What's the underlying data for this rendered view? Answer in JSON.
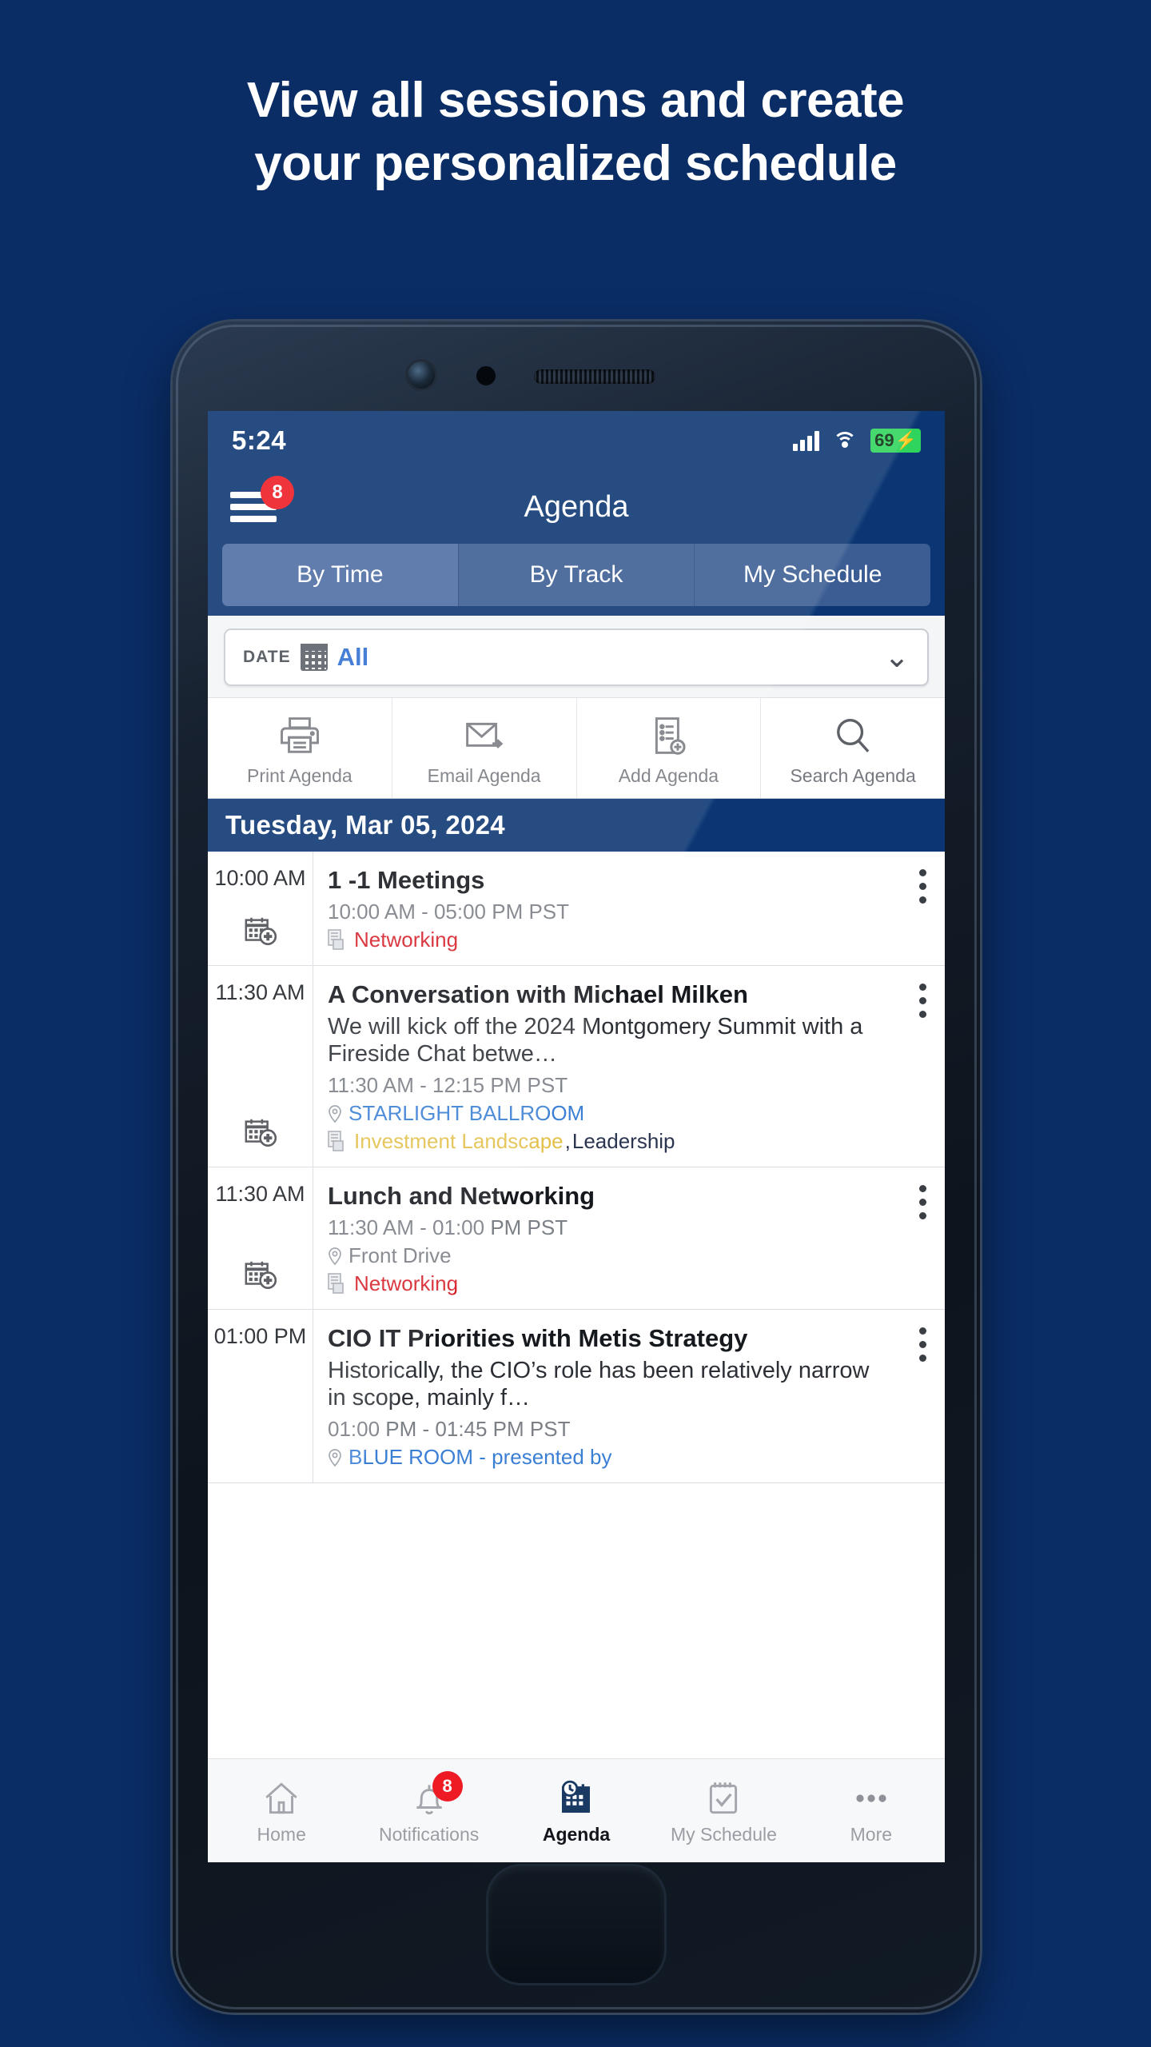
{
  "promo": {
    "headline_line1": "View all sessions and create",
    "headline_line2": "your personalized schedule",
    "background_color": "#0a2d66"
  },
  "status_bar": {
    "time": "5:24",
    "signal_icon": "signal-bars-icon",
    "wifi_icon": "wifi-icon",
    "battery_level": "69",
    "battery_charging": "⚡"
  },
  "app_bar": {
    "menu_icon": "hamburger-menu-icon",
    "menu_badge": "8",
    "title": "Agenda"
  },
  "segmented_tabs": [
    {
      "label": "By Time",
      "selected": true
    },
    {
      "label": "By Track",
      "selected": false
    },
    {
      "label": "My Schedule",
      "selected": false
    }
  ],
  "date_filter": {
    "label": "DATE",
    "calendar_icon": "calendar-icon",
    "value": "All",
    "chevron_icon": "chevron-down-icon"
  },
  "toolbar": [
    {
      "label": "Print Agenda",
      "icon": "printer-icon"
    },
    {
      "label": "Email Agenda",
      "icon": "envelope-icon"
    },
    {
      "label": "Add Agenda",
      "icon": "document-add-icon"
    },
    {
      "label": "Search Agenda",
      "icon": "search-icon"
    }
  ],
  "date_band": "Tuesday, Mar 05, 2024",
  "sessions": [
    {
      "time": "10:00 AM",
      "title": "1 -1 Meetings",
      "description": "",
      "timerange": "10:00 AM - 05:00 PM PST",
      "location": "",
      "location_color": "",
      "tracks": [
        {
          "text": "Networking",
          "color": "#d6212b"
        }
      ],
      "add_icon": "calendar-add-icon",
      "menu_icon": "kebab-menu-icon"
    },
    {
      "time": "11:30 AM",
      "title": "A Conversation with Michael Milken",
      "description": "We will kick off the 2024 Montgomery Summit with a Fireside Chat betwe…",
      "timerange": "11:30 AM - 12:15 PM PST",
      "location": "STARLIGHT BALLROOM",
      "location_color": "#3b7fd4",
      "tracks": [
        {
          "text": "Investment Landscape",
          "color": "#e3c04a"
        },
        {
          "text": ", ",
          "color": "#2b3550"
        },
        {
          "text": "Leadership",
          "color": "#2b3550"
        }
      ],
      "add_icon": "calendar-add-icon",
      "menu_icon": "kebab-menu-icon"
    },
    {
      "time": "11:30 AM",
      "title": "Lunch and Networking",
      "description": "",
      "timerange": "11:30 AM - 01:00 PM PST",
      "location": "Front Drive",
      "location_color": "#7b7f86",
      "tracks": [
        {
          "text": "Networking",
          "color": "#d6212b"
        }
      ],
      "add_icon": "calendar-add-icon",
      "menu_icon": "kebab-menu-icon"
    },
    {
      "time": "01:00 PM",
      "title": "CIO IT Priorities with Metis Strategy",
      "description": "Historically, the CIO’s role has been relatively narrow in scope, mainly f…",
      "timerange": "01:00 PM - 01:45 PM PST",
      "location": "BLUE ROOM  - presented by",
      "location_color": "#3b7fd4",
      "tracks": [],
      "add_icon": "calendar-add-icon",
      "menu_icon": "kebab-menu-icon"
    }
  ],
  "bottom_nav": [
    {
      "label": "Home",
      "icon": "home-icon",
      "active": false,
      "badge": ""
    },
    {
      "label": "Notifications",
      "icon": "bell-icon",
      "active": false,
      "badge": "8"
    },
    {
      "label": "Agenda",
      "icon": "agenda-calendar-clock-icon",
      "active": true,
      "badge": ""
    },
    {
      "label": "My Schedule",
      "icon": "checklist-icon",
      "active": false,
      "badge": ""
    },
    {
      "label": "More",
      "icon": "ellipsis-icon",
      "active": false,
      "badge": ""
    }
  ]
}
